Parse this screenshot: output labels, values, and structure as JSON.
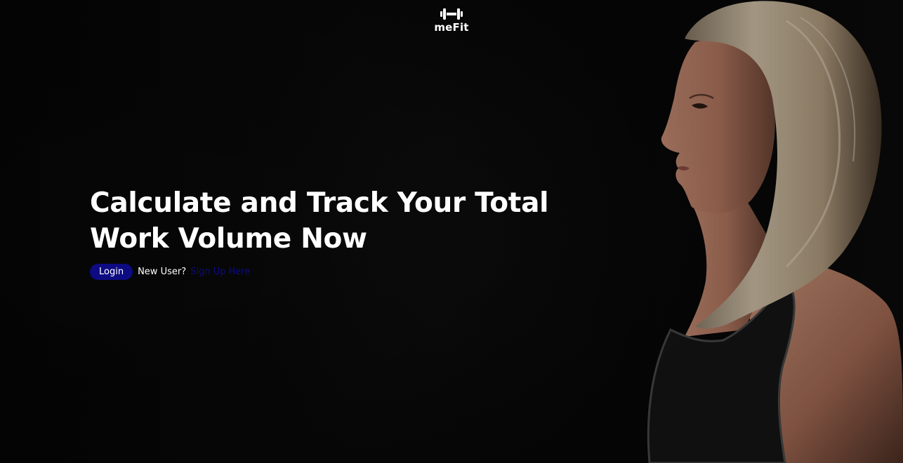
{
  "brand": {
    "name": "meFit",
    "icon": "dumbbell-icon"
  },
  "hero": {
    "headline_line1": "Calculate and Track Your Total",
    "headline_line2": "Work Volume Now",
    "login_label": "Login",
    "new_user_text": "New User?",
    "signup_label": "Sign Up Here"
  },
  "colors": {
    "background": "#050505",
    "accent": "#0d0b82",
    "text": "#ffffff"
  }
}
